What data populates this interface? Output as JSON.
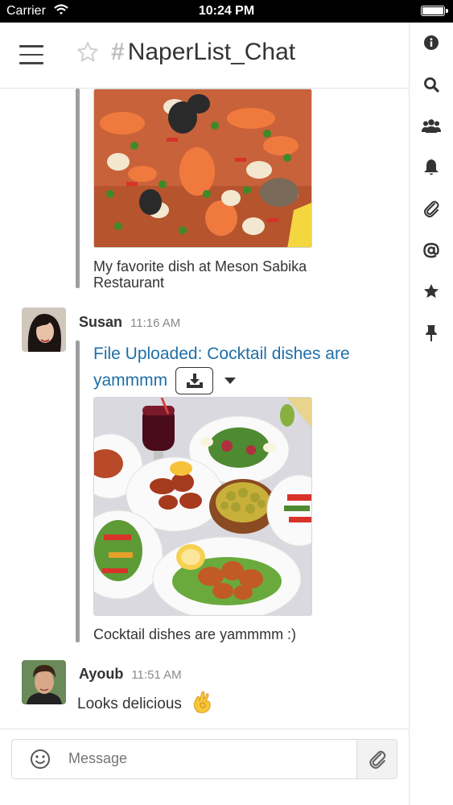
{
  "status_bar": {
    "carrier": "Carrier",
    "time": "10:24 PM",
    "battery_level": 1.0
  },
  "header": {
    "channel_prefix": "#",
    "channel_name": "NaperList_Chat",
    "menu_icon": "hamburger-icon",
    "favorite_icon": "star-outline-icon"
  },
  "sidebar": {
    "items": [
      {
        "icon": "info-icon"
      },
      {
        "icon": "search-icon"
      },
      {
        "icon": "members-icon"
      },
      {
        "icon": "bell-icon"
      },
      {
        "icon": "paperclip-icon"
      },
      {
        "icon": "mention-icon"
      },
      {
        "icon": "star-icon"
      },
      {
        "icon": "pin-icon"
      }
    ]
  },
  "messages": [
    {
      "caption": "My favorite dish at Meson Sabika Restaurant"
    },
    {
      "username": "Susan",
      "time": "11:16 AM",
      "file_title": "File Uploaded: Cocktail dishes are yammmm",
      "caption": "Cocktail dishes are yammmm :)"
    },
    {
      "username": "Ayoub",
      "time": "11:51 AM",
      "text": "Looks delicious"
    }
  ],
  "composer": {
    "placeholder": "Message",
    "emoji_icon": "emoji-icon",
    "attach_icon": "paperclip-icon"
  },
  "colors": {
    "link": "#1f6fa8",
    "attachment_bar": "#9e9e9e"
  }
}
